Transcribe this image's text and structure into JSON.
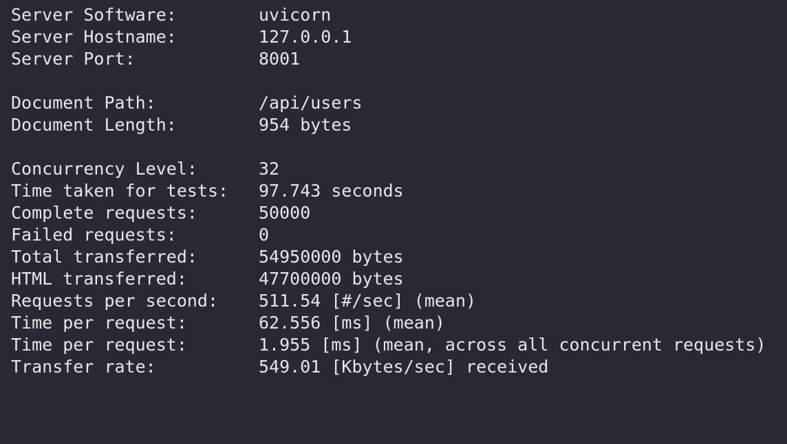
{
  "terminal": {
    "groups": [
      [
        {
          "label": "Server Software:",
          "value": "uvicorn"
        },
        {
          "label": "Server Hostname:",
          "value": "127.0.0.1"
        },
        {
          "label": "Server Port:",
          "value": "8001"
        }
      ],
      [
        {
          "label": "Document Path:",
          "value": "/api/users"
        },
        {
          "label": "Document Length:",
          "value": "954 bytes"
        }
      ],
      [
        {
          "label": "Concurrency Level:",
          "value": "32"
        },
        {
          "label": "Time taken for tests:",
          "value": "97.743 seconds"
        },
        {
          "label": "Complete requests:",
          "value": "50000"
        },
        {
          "label": "Failed requests:",
          "value": "0"
        },
        {
          "label": "Total transferred:",
          "value": "54950000 bytes"
        },
        {
          "label": "HTML transferred:",
          "value": "47700000 bytes"
        },
        {
          "label": "Requests per second:",
          "value": "511.54 [#/sec] (mean)"
        },
        {
          "label": "Time per request:",
          "value": "62.556 [ms] (mean)"
        },
        {
          "label": "Time per request:",
          "value": "1.955 [ms] (mean, across all concurrent requests)"
        },
        {
          "label": "Transfer rate:",
          "value": "549.01 [Kbytes/sec] received"
        }
      ]
    ]
  }
}
